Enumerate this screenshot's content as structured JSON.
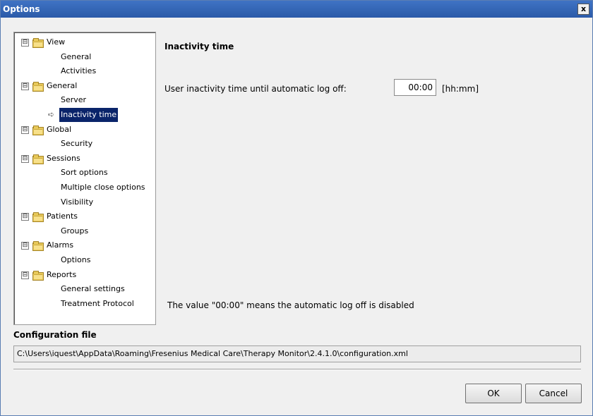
{
  "window": {
    "title": "Options",
    "close_label": "x"
  },
  "tree": {
    "expander_symbol": "⊟",
    "groups": [
      {
        "label": "View",
        "children": [
          "General",
          "Activities"
        ]
      },
      {
        "label": "General",
        "children": [
          "Server",
          "Inactivity time"
        ]
      },
      {
        "label": "Global",
        "children": [
          "Security"
        ]
      },
      {
        "label": "Sessions",
        "children": [
          "Sort options",
          "Multiple close options",
          "Visibility"
        ]
      },
      {
        "label": "Patients",
        "children": [
          "Groups"
        ]
      },
      {
        "label": "Alarms",
        "children": [
          "Options"
        ]
      },
      {
        "label": "Reports",
        "children": [
          "General settings",
          "Treatment Protocol"
        ]
      }
    ],
    "selected": "Inactivity time"
  },
  "panel": {
    "title": "Inactivity time",
    "field_label": "User inactivity time until automatic log off:",
    "value": "00:00",
    "unit": "[hh:mm]",
    "note": "The value \"00:00\" means the automatic log off is disabled"
  },
  "config": {
    "label": "Configuration file",
    "path": "C:\\Users\\iquest\\AppData\\Roaming\\Fresenius Medical Care\\Therapy Monitor\\2.4.1.0\\configuration.xml"
  },
  "buttons": {
    "ok": "OK",
    "cancel": "Cancel"
  },
  "colors": {
    "titlebar": "#2b5aa8",
    "selection": "#0a246a"
  }
}
